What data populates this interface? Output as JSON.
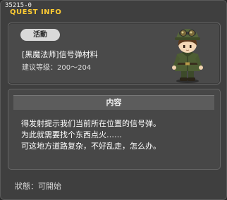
{
  "window": {
    "quest_id": "35215-0",
    "title": "QUEST INFO"
  },
  "quest": {
    "category_badge": "活動",
    "name": "[黑魔法师]信号弹材料",
    "level_requirement": "建议等级：200～204",
    "npc_icon": "npc-soldier-portrait"
  },
  "content": {
    "header": "内容",
    "lines": [
      "得发射提示我们当前所在位置的信号弹。",
      "为此就需要找个东西点火……",
      "可这地方道路复杂，不好乱走，怎么办。"
    ]
  },
  "status": {
    "text": "狀態：可開始"
  },
  "colors": {
    "title": "#ffcc33",
    "panel": "#4a4a4a",
    "badge": "#d9d9d9"
  }
}
